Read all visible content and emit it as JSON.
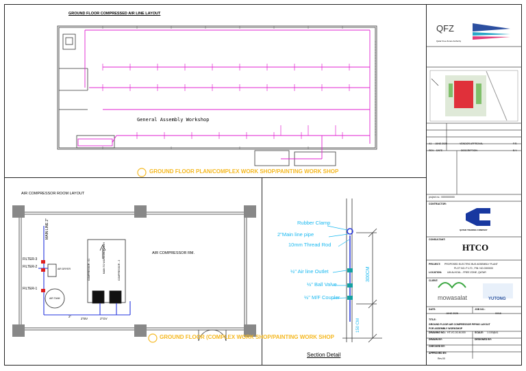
{
  "titles": {
    "ground_floor_layout": "GROUND FLOOR COMPRESSED AIR LINE LAYOUT",
    "compressor_room_layout": "AIR COMPRESSOR ROOM  LAYOUT",
    "section_detail": "Section Detail"
  },
  "plan": {
    "workshop_label": "General Assembly Workshop",
    "watermark_1": "GROUND FLOOR PLAN/COMPLEX WORK SHOP/PAINTING  WORK SHOP",
    "watermark_2": "GROUND FLOOR (COMPLEX WORK SHOP/PAINTING  WORK SHOP"
  },
  "compressor_room": {
    "room_label": "AIR COMPRESSOR RM.",
    "filter_3": "FILTER-3",
    "filter_2": "FILTER-2",
    "filter_1": "FILTER-1",
    "air_dryer": "AIR DRYER",
    "air_tank": "AIR TANK",
    "compressor_1": "COMPRESSOR - 01",
    "compressor_2": "COMPRESSOR - 2",
    "main_line": "MAIN LINE 2\"",
    "to_workshop": "MAIN TO WORKSHOP PATH",
    "bv_label_1": "2\"BV",
    "bv_label_2": "2\"BV",
    "gv_label": "2\"GV",
    "size_label": "2\""
  },
  "section": {
    "rubber_clamp": "Rubber Clamp",
    "main_line_pipe": "2\"Main line pipe",
    "thread_rod": "10mm Thread Rod",
    "air_line_outlet": "½\"  Air line Outlet",
    "ball_valve": "½\" Ball Valve",
    "mf_coupler": "½\" M/F Coupler",
    "dim_300": "300CM",
    "dim_150": "150 CM"
  },
  "title_block": {
    "client_logo_text": "QFZ",
    "client_sub": "Qatar Free Zones Authority",
    "rev_row_1": [
      "A1",
      "JUNE 2025",
      "VENDOR APPROVAL",
      "P.R."
    ],
    "rev_header": [
      "REV.",
      "DATE",
      "DESCRIPTION",
      "B.Y."
    ],
    "project_no": "project no.: 0000000000",
    "contractor_label": "CONTRACTOR:",
    "contractor_name": "QATAR TRADING COMPANY",
    "consultant_label": "CONSULTANT:",
    "consultant_logo": "HTCO",
    "project_label": "PROJECT:",
    "project_name": "PROPOSED ELECTRIC BUS ASSEMBLY PLANT",
    "project_plot": "PLOT NO.:P-170 , PIN: NO.0000000",
    "location_label": "LOCATION:",
    "location_name": "UM ALHOUL - FREE ZONE ,QATAR",
    "client_label": "CLIENT:",
    "client_a": "mowasalat",
    "client_b": "YUTONG",
    "date_label": "DATE:",
    "date_value": "JUNE 2025",
    "job_label": "JOB NO.:",
    "job_value": "00/18",
    "title_label": "TITLE:",
    "drawing_title_1": "GROUND FLOOR AIR COMPRESSOR PIPING LAYOUT",
    "drawing_title_2": "FOR ASSEMBLY WORKSHOP",
    "drawing_no_label": "DRAWING NO.:",
    "drawing_no": "HT-VC-00-M-000",
    "scale_label": "SCALE:",
    "scale_value": "1:100@A1",
    "drawn_label": "DRAWN BY:",
    "checked_label": "CHECKED BY:",
    "approved_label": "APPROVED BY:",
    "designed_label": "DESIGNED BY:",
    "sheet_label": "Rev.00"
  },
  "colors": {
    "pipe_magenta": "#e020d0",
    "pipe_blue": "#2233dd",
    "label_cyan": "#18b8f0",
    "watermark_orange": "#f5b820",
    "column_gray": "#888888"
  }
}
